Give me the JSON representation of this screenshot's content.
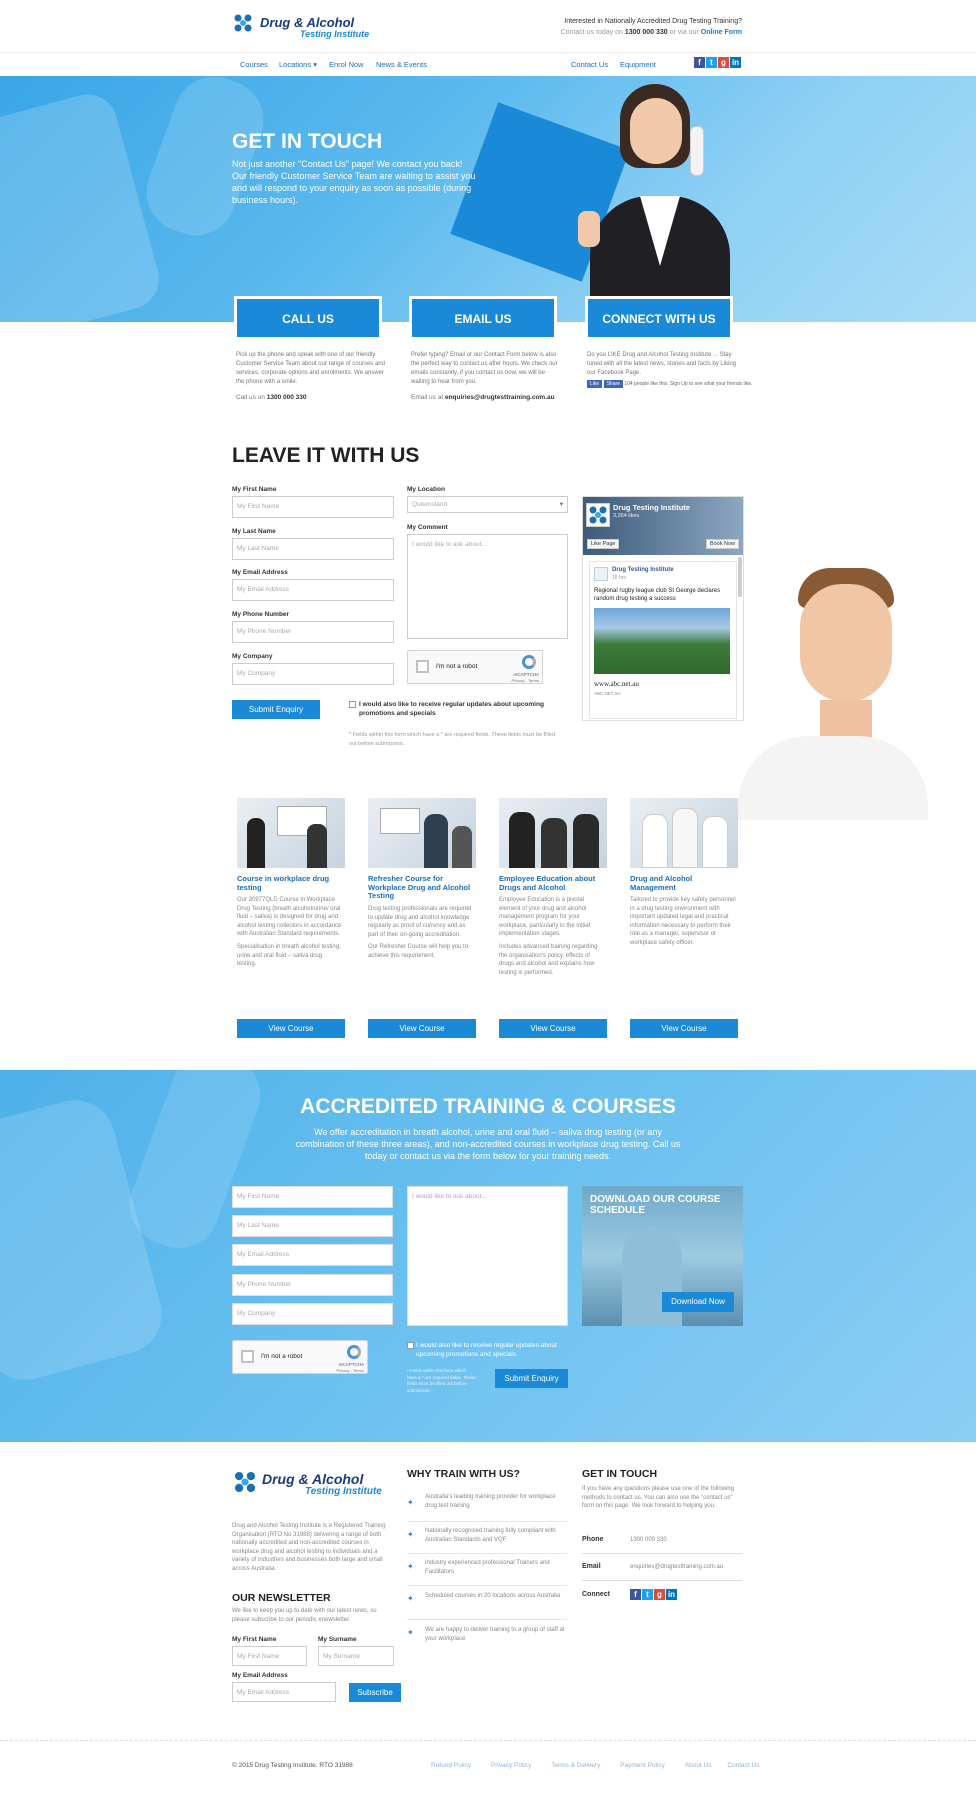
{
  "header": {
    "logo_line1": "Drug & Alcohol",
    "logo_line2": "Testing Institute",
    "tagline": "Interested in Nationally Accredited Drug Testing Training?",
    "contact_prefix": "Contact us today on",
    "phone": "1300 000 330",
    "contact_mid": "or via our",
    "online_form": "Online Form"
  },
  "nav": {
    "courses": "Courses",
    "locations": "Locations",
    "enrol": "Enrol Now",
    "news": "News & Events",
    "contact": "Contact Us",
    "equipment": "Equipment"
  },
  "hero": {
    "title": "GET IN TOUCH",
    "text": "Not just another \"Contact Us\" page!  We contact you back! Our friendly Customer Service Team are waiting to assist you and will respond to your enquiry as soon as possible (during business hours)."
  },
  "cta": [
    {
      "label": "CALL US",
      "text": "Pick up the phone and speak with one of our friendly Customer Service Team about our range of courses and services, corporate options and enrolments. We answer the phone with a smile.",
      "foot_prefix": "Call us on",
      "foot_value": "1300 000 330"
    },
    {
      "label": "EMAIL US",
      "text": "Prefer typing? Email or our Contact Form below is also the perfect way to contact us after hours. We check our emails constantly, if you contact us now, we will be waiting to hear from you.",
      "foot_prefix": "Email us at",
      "foot_value": "enquiries@drugtesttraining.com.au"
    },
    {
      "label": "CONNECT WITH US",
      "text": "Do you LIKE Drug and Alcohol Testing Institute ... Stay tuned with all the latest news, stories and facts by Liking our Facebook Page.",
      "like": "Like",
      "share": "Share",
      "likes_text": "104 people like this.",
      "signup_text": "Sign Up to see what your friends like."
    }
  ],
  "form": {
    "title": "LEAVE IT WITH US",
    "first_name": "My First Name",
    "first_ph": "My First Name",
    "last_name": "My Last Name",
    "last_ph": "My Last Name",
    "email": "My Email Address",
    "email_ph": "My Email Address",
    "phone": "My Phone Number",
    "phone_ph": "My Phone Number",
    "company": "My Company",
    "company_ph": "My Company",
    "location": "My Location",
    "location_val": "Queensland",
    "comment": "My Comment",
    "comment_ph": "I would like to ask about...",
    "captcha": "I'm not a robot",
    "recaptcha": "reCAPTCHA",
    "recaptcha_sub": "Privacy - Terms",
    "submit": "Submit Enquiry",
    "updates": "I would also like to receive regular updates about upcoming promotions and specials",
    "note": "* Fields within this form which have a * are required fields. These fields must be filled out before submission."
  },
  "fb_widget": {
    "page_name": "Drug Testing Institute",
    "likes": "3,264 likes",
    "like_page": "Like Page",
    "book_now": "Book Now",
    "post_name": "Drug Testing Institute",
    "post_time": "18 hrs",
    "post_text": "Regional rugby league club St George declares random drug testing a success",
    "link_title": "www.abc.net.au",
    "link_domain": "ABC.NET.AU"
  },
  "courses": [
    {
      "title": "Course in workplace drug testing",
      "desc1": "Our 30977QLD Course in Workplace Drug Testing (breath alcohol/urine/ oral fluid – saliva) is designed for drug and alcohol testing collectors in accordance with Australian Standard requirements.",
      "desc2": "Specialisation in breath alcohol testing, urine and oral fluid – saliva drug testing.",
      "btn": "View Course"
    },
    {
      "title": "Refresher Course for Workplace Drug and Alcohol Testing",
      "desc1": "Drug testing professionals are required to update drug and alcohol knowledge regularly as proof of currency and as part of their on-going accreditation.",
      "desc2": "Our Refresher Course will help you to achieve this requirement.",
      "btn": "View Course"
    },
    {
      "title": "Employee Education about Drugs and Alcohol",
      "desc1": "Employee Education is a pivotal element of your drug and alcohol management program for your workplace, particularly in the initial implementation stages.",
      "desc2": "Includes advanced training regarding the organisation's policy, effects of drugs and alcohol and explains how testing is performed.",
      "btn": "View Course"
    },
    {
      "title": "Drug and Alcohol Management",
      "desc1": "Tailored to provide key safety personnel in a drug testing environment with important updated legal and practical information necessary to perform their role as a manager, supervisor or workplace safety officer.",
      "desc2": "",
      "btn": "View Course"
    }
  ],
  "band": {
    "title": "ACCREDITED TRAINING & COURSES",
    "text": "We offer accreditation in breath alcohol, urine and oral fluid – saliva drug testing (or any combination of these three areas), and non-accredited courses in workplace drug testing. Call us today or contact us via the form below for your training needs.",
    "first_ph": "My First Name",
    "last_ph": "My Last Name",
    "email_ph": "My Email Address",
    "phone_ph": "My Phone Number",
    "company_ph": "My Company",
    "comment_ph": "I would like to ask about...",
    "download_title": "DOWNLOAD OUR COURSE SCHEDULE",
    "download_btn": "Download Now",
    "captcha": "I'm not a robot",
    "recaptcha": "reCAPTCHA",
    "recaptcha_sub": "Privacy - Terms",
    "updates": "I would also like to receive regular updates about upcoming promotions and specials",
    "note": "* Fields within this form which have a * are required fields. These fields must be filled out before submission.",
    "submit": "Submit Enquiry"
  },
  "footer": {
    "about": "Drug and Alcohol Testing Institute is a Registered Training Organisation (RTO No 31988) delivering a range of both nationally accredited and non-accredited courses in workplace drug and alcohol testing to individuals and a variety of industries and businesses both large and small across Australia.",
    "newsletter_title": "OUR NEWSLETTER",
    "newsletter_text": "We like to keep you up to date with our latest news, so please subscribe to our periodic enewsletter.",
    "first_label": "My First Name",
    "first_ph": "My First Name",
    "surname_label": "My Surname",
    "surname_ph": "My Surname",
    "email_label": "My Email Address",
    "email_ph": "My Email Address",
    "subscribe": "Subscribe",
    "why_title": "WHY TRAIN WITH US?",
    "why": [
      "Australia's leading training provider for workplace drug test training",
      "Nationally recognised training fully compliant with Australian Standards and VQF",
      "Industry experienced professional Trainers and Facilitators",
      "Scheduled courses in 20 locations across Australia",
      "We are happy to deliver training to a group of staff at your workplace"
    ],
    "touch_title": "GET IN TOUCH",
    "touch_text": "If you have any questions please use one of the following methods to contact us. You can also use the \"contact us\" form on this page. We look forward to helping you.",
    "phone_label": "Phone",
    "phone_val": "1300 000 330",
    "email_label2": "Email",
    "email_val": "enquiries@drugtesttraining.com.au",
    "connect_label": "Connect"
  },
  "bottom": {
    "copyright": "© 2015 Drug Testing Institute. RTO 31988",
    "links": [
      "Refund Policy",
      "Privacy Policy",
      "Terms & Delivery",
      "Payment Policy",
      "About Us",
      "Contact Us"
    ]
  },
  "colors": {
    "primary": "#1a8ad8",
    "dark_blue": "#1a6fb5",
    "band": "#5ab9ee"
  }
}
